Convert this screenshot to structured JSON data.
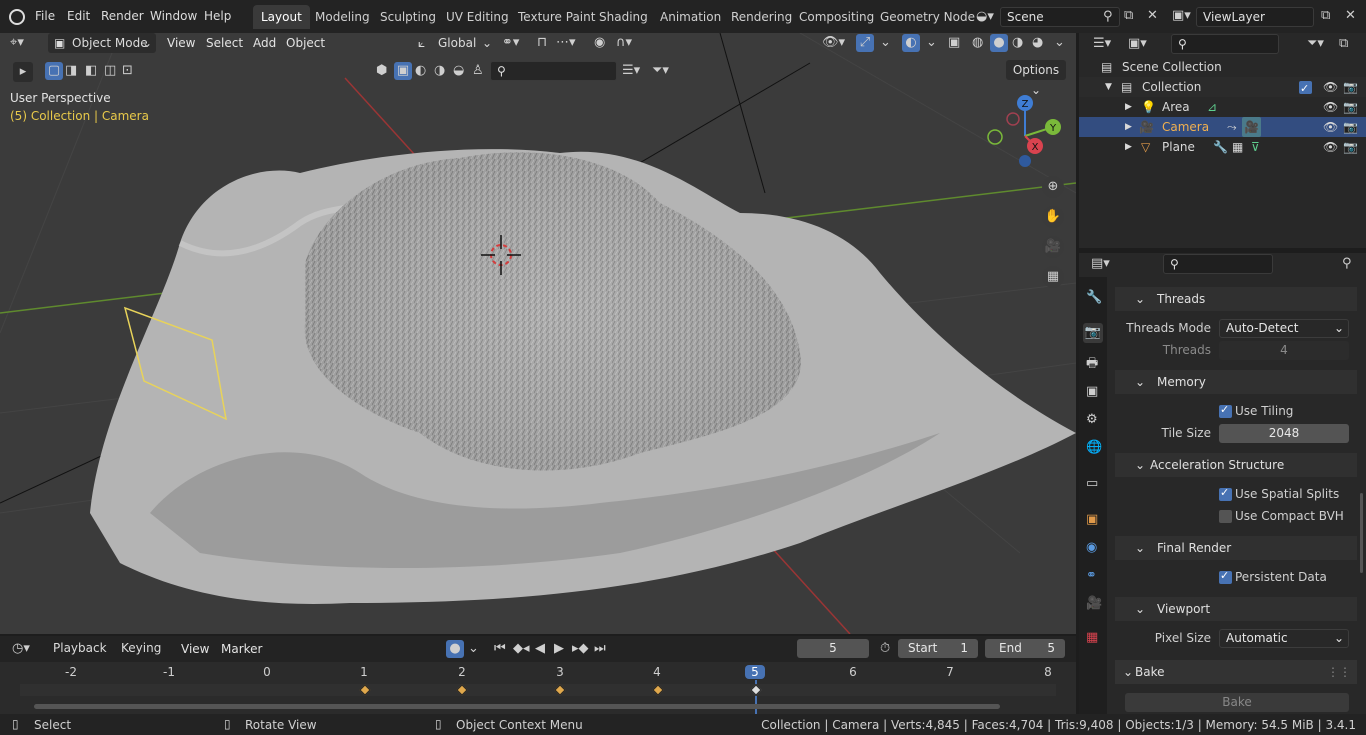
{
  "menu": {
    "file": "File",
    "edit": "Edit",
    "render": "Render",
    "window": "Window",
    "help": "Help"
  },
  "workspaces": [
    "Layout",
    "Modeling",
    "Sculpting",
    "UV Editing",
    "Texture Paint",
    "Shading",
    "Animation",
    "Rendering",
    "Compositing",
    "Geometry Node"
  ],
  "scene": {
    "name": "Scene",
    "view_layer": "ViewLayer"
  },
  "viewport": {
    "mode": "Object Mode",
    "view": "View",
    "select": "Select",
    "add": "Add",
    "object": "Object",
    "orientation": "Global",
    "options": "Options",
    "perspective": "User Perspective",
    "collection_info": "(5) Collection | Camera",
    "gizmo": {
      "z": "Z",
      "y": "Y",
      "x": "X"
    }
  },
  "outliner": {
    "scene_collection": "Scene Collection",
    "collection": "Collection",
    "items": [
      {
        "name": "Area"
      },
      {
        "name": "Camera"
      },
      {
        "name": "Plane"
      }
    ]
  },
  "properties": {
    "threads_panel": "Threads",
    "threads_mode_label": "Threads Mode",
    "threads_mode": "Auto-Detect",
    "threads_label": "Threads",
    "threads": "4",
    "memory_panel": "Memory",
    "use_tiling": "Use Tiling",
    "tile_size_label": "Tile Size",
    "tile_size": "2048",
    "accel_panel": "Acceleration Structure",
    "spatial_splits": "Use Spatial Splits",
    "compact_bvh": "Use Compact BVH",
    "final_render_panel": "Final Render",
    "persistent_data": "Persistent Data",
    "viewport_panel": "Viewport",
    "pixel_size_label": "Pixel Size",
    "pixel_size": "Automatic",
    "bake_panel": "Bake",
    "bake_button": "Bake"
  },
  "timeline": {
    "playback": "Playback",
    "keying": "Keying",
    "view": "View",
    "marker": "Marker",
    "current_frame": "5",
    "start_label": "Start",
    "start": "1",
    "end_label": "End",
    "end": "5",
    "ruler": [
      "-2",
      "-1",
      "0",
      "1",
      "2",
      "3",
      "4",
      "5",
      "6",
      "7",
      "8"
    ]
  },
  "status": {
    "select": "Select",
    "rotate": "Rotate View",
    "context": "Object Context Menu",
    "stats": "Collection | Camera | Verts:4,845 | Faces:4,704 | Tris:9,408 | Objects:1/3 | Memory: 54.5 MiB | 3.4.1"
  },
  "colors": {
    "accent": "#4772b3",
    "keyframe": "#e0a84c",
    "active_text": "#e8a24a"
  }
}
